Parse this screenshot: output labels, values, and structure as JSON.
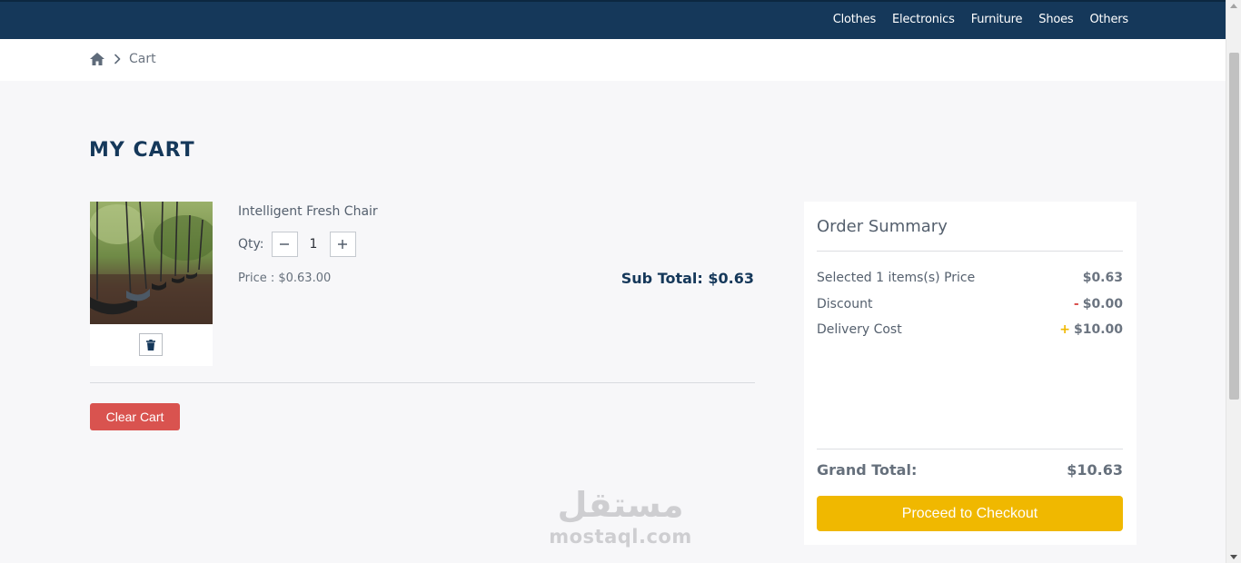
{
  "nav": {
    "items": [
      {
        "label": "Clothes"
      },
      {
        "label": "Electronics"
      },
      {
        "label": "Furniture"
      },
      {
        "label": "Shoes"
      },
      {
        "label": "Others"
      }
    ]
  },
  "breadcrumb": {
    "home_icon": "home-icon",
    "separator_icon": "chevron-right-icon",
    "current": "Cart"
  },
  "page": {
    "title": "MY CART"
  },
  "cart": {
    "item": {
      "name": "Intelligent Fresh Chair",
      "qty_label": "Qty:",
      "qty": "1",
      "price": "Price : $0.63.00",
      "subtotal": "Sub Total: $0.63",
      "image_icon": "product-photo-swings",
      "delete_icon": "trash-icon"
    },
    "clear_label": "Clear Cart"
  },
  "summary": {
    "title": "Order Summary",
    "rows": [
      {
        "label": "Selected 1 items(s) Price",
        "sign": "",
        "value": "$0.63"
      },
      {
        "label": "Discount",
        "sign": "-",
        "value": "$0.00"
      },
      {
        "label": "Delivery Cost",
        "sign": "+",
        "value": "$10.00"
      }
    ],
    "grand_label": "Grand Total:",
    "grand_value": "$10.63",
    "checkout_label": "Proceed to Checkout"
  },
  "watermark": {
    "arabic": "مستقل",
    "latin": "mostaql.com"
  },
  "colors": {
    "navbar": "#15385a",
    "title": "#15385a",
    "clear_button": "#d9534f",
    "checkout_button": "#f0b800",
    "discount_sign": "#d9534f",
    "delivery_sign": "#f0b800"
  }
}
